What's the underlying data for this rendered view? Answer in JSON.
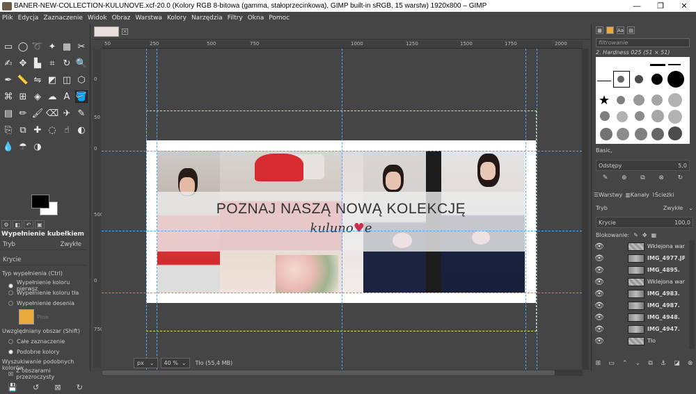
{
  "window": {
    "title": "BANER-NEW-COLLECTION-KULUNOVE.xcf-20.0 (Kolory RGB 8-bitowa (gamma, stałoprzecinkowa), GIMP built-in sRGB, 15 warstw) 1920x800 – GIMP",
    "minimize": "—",
    "maximize": "❐",
    "close": "✕"
  },
  "menu": [
    "Plik",
    "Edycja",
    "Zaznaczenie",
    "Widok",
    "Obraz",
    "Warstwa",
    "Kolory",
    "Narzędzia",
    "Filtry",
    "Okna",
    "Pomoc"
  ],
  "tools": [
    {
      "icon": "rect-select-icon",
      "glyph": "▭"
    },
    {
      "icon": "ellipse-select-icon",
      "glyph": "◯"
    },
    {
      "icon": "lasso-icon",
      "glyph": "➰"
    },
    {
      "icon": "fuzzy-select-icon",
      "glyph": "✦"
    },
    {
      "icon": "color-select-icon",
      "glyph": "▦"
    },
    {
      "icon": "scissors-icon",
      "glyph": "✂"
    },
    {
      "icon": "foreground-select-icon",
      "glyph": "✍"
    },
    {
      "icon": "move-icon",
      "glyph": "✥"
    },
    {
      "icon": "align-icon",
      "glyph": "▙"
    },
    {
      "icon": "crop-icon",
      "glyph": "⌗"
    },
    {
      "icon": "rotate-icon",
      "glyph": "↻"
    },
    {
      "icon": "zoom-icon",
      "glyph": "🔍"
    },
    {
      "icon": "paths-icon",
      "glyph": "✒"
    },
    {
      "icon": "measure-icon",
      "glyph": "📏"
    },
    {
      "icon": "flip-icon",
      "glyph": "⇋"
    },
    {
      "icon": "shear-icon",
      "glyph": "◩"
    },
    {
      "icon": "perspective-icon",
      "glyph": "◫"
    },
    {
      "icon": "cage-icon",
      "glyph": "⬡"
    },
    {
      "icon": "warp-icon",
      "glyph": "⌘"
    },
    {
      "icon": "unified-transform-icon",
      "glyph": "⊞"
    },
    {
      "icon": "handle-transform-icon",
      "glyph": "◈"
    },
    {
      "icon": "smudge-warp-icon",
      "glyph": "☁"
    },
    {
      "icon": "text-icon",
      "glyph": "A"
    },
    {
      "icon": "bucket-fill-icon",
      "glyph": "🪣"
    },
    {
      "icon": "gradient-icon",
      "glyph": "▤"
    },
    {
      "icon": "pencil-icon",
      "glyph": "✏"
    },
    {
      "icon": "paintbrush-icon",
      "glyph": "🖌"
    },
    {
      "icon": "eraser-icon",
      "glyph": "⌫"
    },
    {
      "icon": "airbrush-icon",
      "glyph": "✈"
    },
    {
      "icon": "ink-icon",
      "glyph": "✎"
    },
    {
      "icon": "clone-icon",
      "glyph": "⎘"
    },
    {
      "icon": "perspective-clone-icon",
      "glyph": "⧉"
    },
    {
      "icon": "heal-icon",
      "glyph": "✚"
    },
    {
      "icon": "blur-icon",
      "glyph": "◌"
    },
    {
      "icon": "smudge-icon",
      "glyph": "☝"
    },
    {
      "icon": "dodge-icon",
      "glyph": "◐"
    },
    {
      "icon": "color-picker-icon",
      "glyph": "💧"
    },
    {
      "icon": "mypaint-icon",
      "glyph": "☂"
    },
    {
      "icon": "levels-icon",
      "glyph": "◑"
    }
  ],
  "tool_options": {
    "title": "Wypełnienie kubełkiem",
    "mode_label": "Tryb",
    "mode_value": "Zwykłe",
    "opacity_label": "Krycie",
    "fill_type_label": "Typ wypełnienia  (Ctrl)",
    "fill_options": [
      "Wypełnienie koloru pierwsz",
      "Wypełnienie koloru tła",
      "Wypełnienie desenia"
    ],
    "pattern_name": "Pine",
    "area_label": "Uwzględniany obszar  (Shift)",
    "area_options": [
      "Całe zaznaczenie",
      "Podobne kolory"
    ],
    "similar_label": "Wyszukiwanie podobnych kolorów",
    "sample_merged": "Z obszarami przezroczysty"
  },
  "image_tab": {
    "close": "✕"
  },
  "ruler_h": [
    "50",
    "250",
    "500",
    "750",
    "1000",
    "1250",
    "1500",
    "1750",
    "2000"
  ],
  "ruler_v": [
    "0",
    "50",
    "0",
    "500",
    "0",
    "750"
  ],
  "banner": {
    "headline": "POZNAJ NASZĄ NOWĄ KOLEKCJĘ",
    "brand_pre": "kuluno",
    "brand_heart": "♥",
    "brand_post": "e"
  },
  "status": {
    "unit": "px",
    "zoom": "40 %",
    "info": "Tło (55,4 MB)"
  },
  "right_panel": {
    "filter_placeholder": "filtrowanie",
    "brush_name": "2. Hardness 025 (51 × 51)",
    "preset": "Basic,",
    "spacing_label": "Odstępy",
    "spacing_value": "5,0",
    "tabs": [
      "Warstwy",
      "Kanały",
      "Ścieżki"
    ],
    "mode_label": "Tryb",
    "mode_value": "Zwykłe",
    "opacity_label": "Krycie",
    "opacity_value": "100,0",
    "lock_label": "Blokowanie:",
    "layers": [
      "Wklejona war",
      "IMG_4977.JP",
      "IMG_4895.",
      "Wklejona war",
      "IMG_4983.",
      "IMG_4987.",
      "IMG_4948.",
      "IMG_4947.",
      "Tło"
    ]
  },
  "colors": {
    "accent_guide": "#4aa6ff",
    "selection": "#e8e35a",
    "heart": "#c8324a",
    "dress_red": "#d8262a",
    "dress_navy": "#1b2340"
  }
}
